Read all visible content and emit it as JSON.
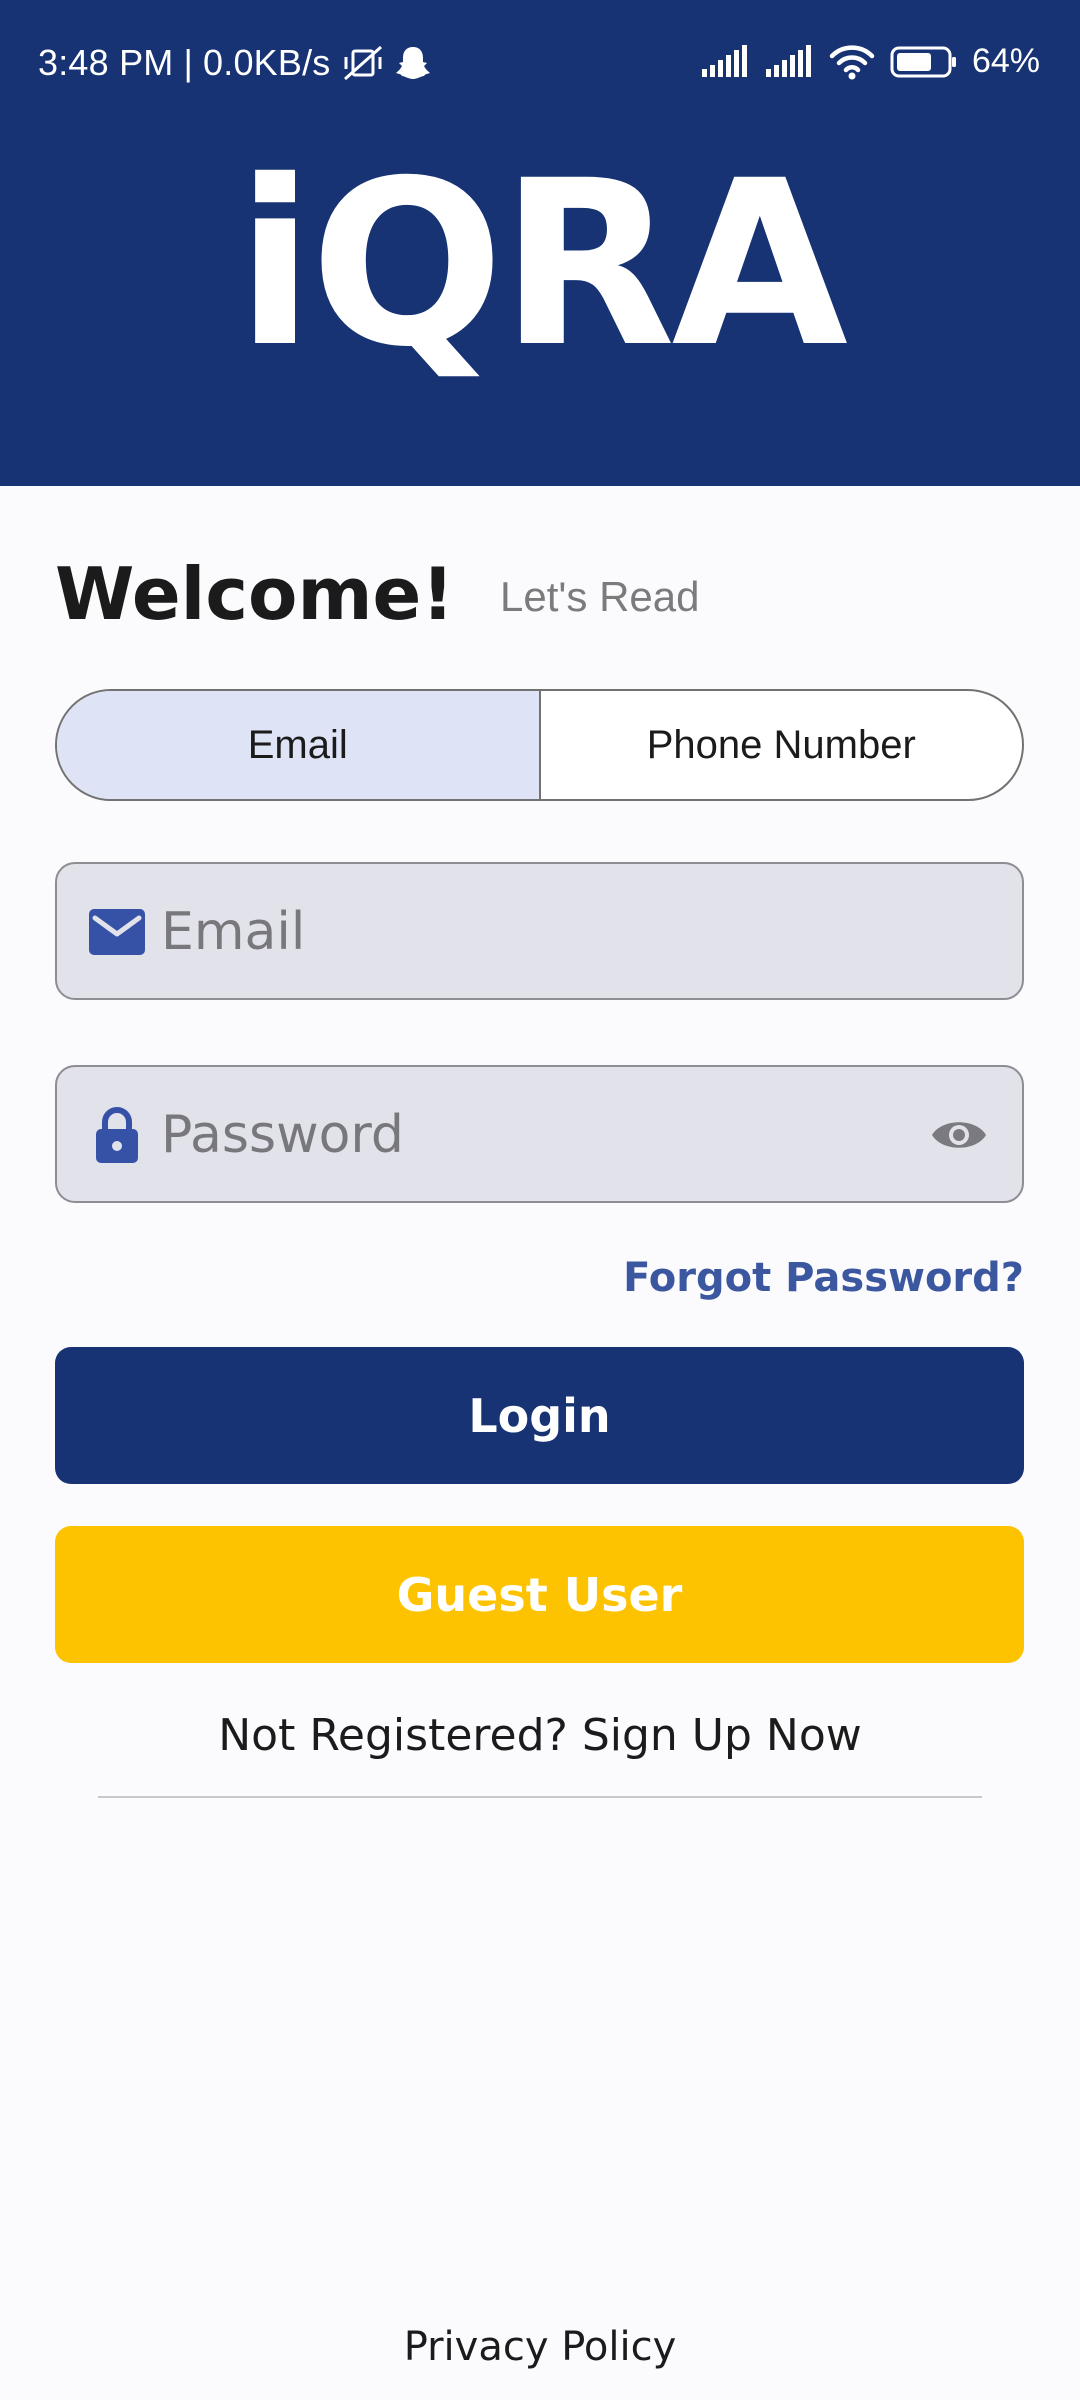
{
  "status_bar": {
    "time": "3:48 PM",
    "separator": "|",
    "network_speed": "0.0KB/s",
    "battery": "64%",
    "icons": [
      "vibrate-mute-icon",
      "snapchat-ghost-icon",
      "signal-icon",
      "signal-icon",
      "wifi-icon",
      "battery-icon"
    ]
  },
  "app": {
    "logo_text": "iQRA"
  },
  "greeting": {
    "title": "Welcome!",
    "subtitle": "Let's Read"
  },
  "login_method": {
    "options": [
      "Email",
      "Phone Number"
    ],
    "selected": "Email"
  },
  "form": {
    "email_placeholder": "Email",
    "email_value": "",
    "password_placeholder": "Password",
    "password_value": "",
    "forgot_label": "Forgot Password?"
  },
  "actions": {
    "login_label": "Login",
    "guest_label": "Guest User",
    "signup_label": "Not Registered? Sign Up Now"
  },
  "footer": {
    "privacy_label": "Privacy Policy"
  },
  "colors": {
    "primary": "#173374",
    "accent_yellow": "#fec300",
    "link": "#3b57a0",
    "toggle_active_bg": "#dee3f6",
    "field_bg": "#e2e2ea",
    "icon_blue": "#3552a6"
  }
}
